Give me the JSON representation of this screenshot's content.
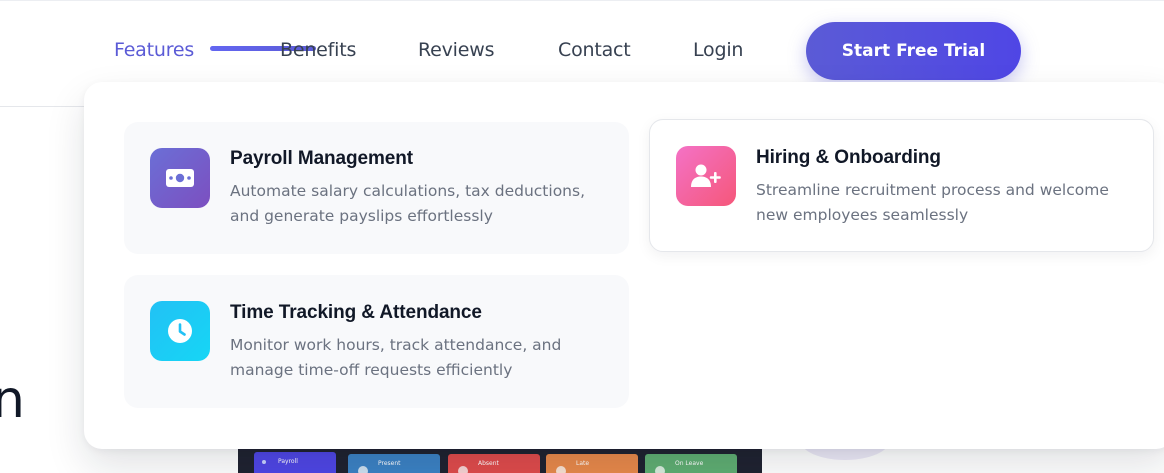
{
  "nav": {
    "links": [
      {
        "label": "Features",
        "active": true
      },
      {
        "label": "Benefits"
      },
      {
        "label": "Reviews"
      },
      {
        "label": "Contact"
      },
      {
        "label": "Login"
      }
    ],
    "cta_label": "Start Free Trial"
  },
  "colors": {
    "accent": "#5b5bd6",
    "payroll_icon": "#6b6fd6",
    "hiring_icon": "#f472c6",
    "time_icon": "#22c1f5"
  },
  "dropdown": {
    "cards": [
      {
        "icon": "money-bill-icon",
        "title": "Payroll Management",
        "description": "Automate salary calculations, tax deductions, and generate payslips effortlessly"
      },
      {
        "icon": "user-plus-icon",
        "title": "Hiring & Onboarding",
        "description": "Streamline recruitment process and welcome new employees seamlessly"
      },
      {
        "icon": "clock-icon",
        "title": "Time Tracking & Attendance",
        "description": "Monitor work hours, track attendance, and manage time-off requests efficiently"
      }
    ]
  },
  "background": {
    "hero_glyph": "n",
    "preview": {
      "sidebar_item": "Payroll",
      "tiles": [
        "Present",
        "Absent",
        "Late",
        "On Leave"
      ]
    }
  }
}
